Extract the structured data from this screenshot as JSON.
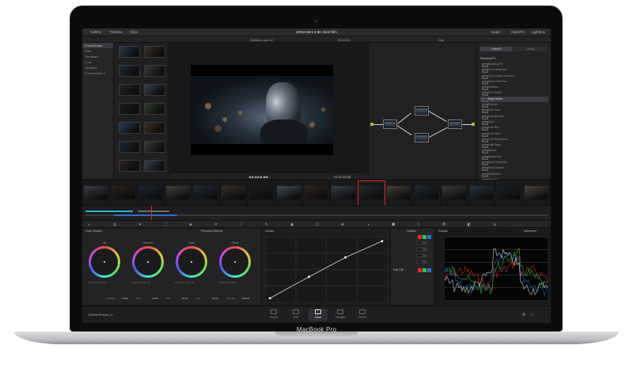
{
  "device": {
    "brand_label": "MacBook Pro"
  },
  "app": {
    "project_title": "URSA Mini 4.6K short film",
    "topbar": {
      "gallery": "Gallery",
      "timelines": "Timeline",
      "clips": "Clips",
      "nodes": "Node",
      "openfx": "OpenFX",
      "lightbox": "Lightbox"
    },
    "viewer": {
      "clip_name": "Stylistic Look 02",
      "timecode_left": "00:00:00",
      "timecode_out": "01:00:25:08"
    },
    "nodes_header": "Clip",
    "library": {
      "tab_openfx": "OpenFX",
      "tab_library": "Library",
      "section": "ResolveFX",
      "items": [
        "Blanking Fill",
        "Color Generator",
        "Color Space Transform",
        "Dead Pixel Fixer",
        "Deflicker",
        "Dust Buster",
        "Edge Detect",
        "Emboss",
        "Film Grain",
        "Gaussian Blur",
        "Glow",
        "Lens Blur",
        "Lens Flare",
        "Lens Reflections",
        "Light Rays",
        "Mirrors",
        "Mosaic Blur",
        "Noise Reduction",
        "Pencil Sketch",
        "Radial Blur",
        "Sharpen",
        "Tilt-Shift Blur",
        "Vignette",
        "Warper"
      ],
      "selected_index": 6
    }
  },
  "sidebar": {
    "items": [
      "PowerGrade",
      "Stills",
      "Timelines",
      "Look",
      "Spotlight",
      "PowerGrade 2"
    ],
    "selected_index": 0
  },
  "color_wheels": {
    "panel_title": "Color Wheels",
    "mode": "Primaries Wheels",
    "wheels": [
      {
        "label": "Lift",
        "values": "0.00 0.00 0.00 0.00"
      },
      {
        "label": "Gamma",
        "values": "0.00 0.00 0.00 0.00"
      },
      {
        "label": "Gain",
        "values": "1.00 1.00 1.00 1.00"
      },
      {
        "label": "Offset",
        "values": "25.00 25.00 25.00"
      }
    ],
    "sliders": [
      {
        "label": "Contrast",
        "value": "1.000"
      },
      {
        "label": "Pivot",
        "value": "0.435"
      },
      {
        "label": "Sat",
        "value": "50.00"
      },
      {
        "label": "Hue",
        "value": "50.00"
      },
      {
        "label": "Lum Mix",
        "value": "100.00"
      }
    ]
  },
  "curves": {
    "title": "Curves",
    "points": [
      [
        0.04,
        0.95
      ],
      [
        0.36,
        0.62
      ],
      [
        0.66,
        0.32
      ],
      [
        0.96,
        0.07
      ]
    ]
  },
  "custom_panel": {
    "title": "Custom",
    "fields": [
      "100",
      "100",
      "100",
      "100"
    ],
    "soft_clip": "Soft Clip"
  },
  "scope": {
    "title": "Scopes",
    "mode": "Waveform"
  },
  "pages": {
    "tabs": [
      "Media",
      "Edit",
      "Color",
      "Fairlight",
      "Deliver"
    ],
    "active_index": 2
  },
  "status": {
    "app_name": "DaVinci Resolve 14"
  },
  "colors": {
    "accent_red": "#e0302b",
    "accent_teal": "#2bb7c6",
    "node_pip": "#b7b23a"
  }
}
